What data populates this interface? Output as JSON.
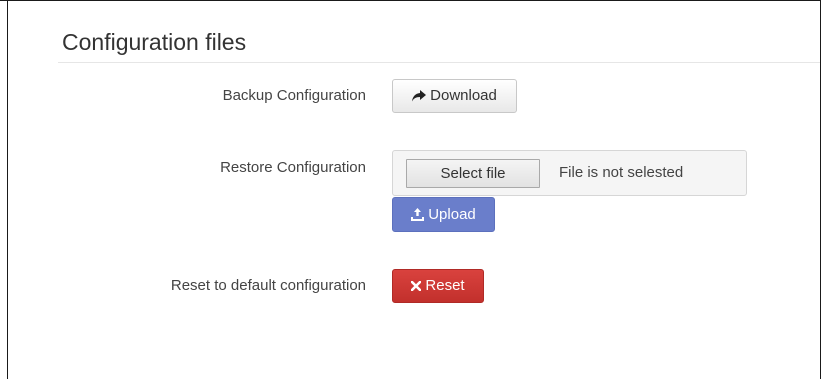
{
  "panel": {
    "title": "Configuration files"
  },
  "backup": {
    "label": "Backup Configuration",
    "button_label": "Download",
    "icon": "share-arrow-icon"
  },
  "restore": {
    "label": "Restore Configuration",
    "file_button_label": "Select file",
    "file_status": "File is not selested",
    "upload_label": "Upload",
    "icon": "upload-icon"
  },
  "reset": {
    "label": "Reset to default configuration",
    "button_label": "Reset",
    "icon": "close-x-icon"
  },
  "colors": {
    "primary": "#6a7ecb",
    "danger": "#c9342f",
    "text": "#333333"
  }
}
